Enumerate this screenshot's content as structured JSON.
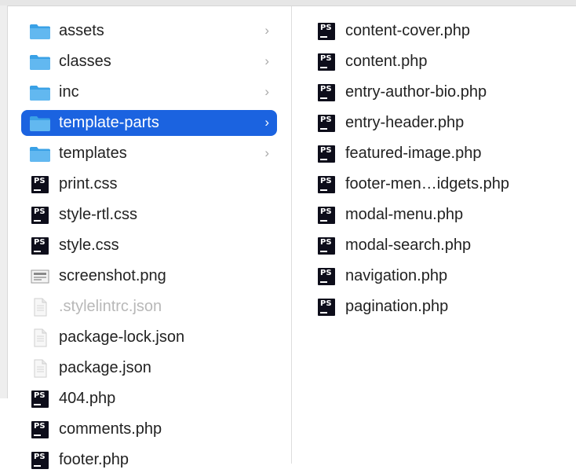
{
  "left_column": {
    "items": [
      {
        "label": "assets",
        "icon": "folder-icon",
        "chevron": "›",
        "selected": false
      },
      {
        "label": "classes",
        "icon": "folder-icon",
        "chevron": "›",
        "selected": false
      },
      {
        "label": "inc",
        "icon": "folder-icon",
        "chevron": "›",
        "selected": false
      },
      {
        "label": "template-parts",
        "icon": "folder-icon",
        "chevron": "›",
        "selected": true
      },
      {
        "label": "templates",
        "icon": "folder-icon",
        "chevron": "›",
        "selected": false
      },
      {
        "label": "print.css",
        "icon": "phpstorm-file-icon"
      },
      {
        "label": "style-rtl.css",
        "icon": "phpstorm-file-icon"
      },
      {
        "label": "style.css",
        "icon": "phpstorm-file-icon"
      },
      {
        "label": "screenshot.png",
        "icon": "image-file-icon"
      },
      {
        "label": ".stylelintrc.json",
        "icon": "document-icon",
        "dimmed": true
      },
      {
        "label": "package-lock.json",
        "icon": "document-icon"
      },
      {
        "label": "package.json",
        "icon": "document-icon"
      },
      {
        "label": "404.php",
        "icon": "phpstorm-file-icon"
      },
      {
        "label": "comments.php",
        "icon": "phpstorm-file-icon"
      },
      {
        "label": "footer.php",
        "icon": "phpstorm-file-icon"
      }
    ]
  },
  "right_column": {
    "items": [
      {
        "label": "content-cover.php",
        "icon": "phpstorm-file-icon"
      },
      {
        "label": "content.php",
        "icon": "phpstorm-file-icon"
      },
      {
        "label": "entry-author-bio.php",
        "icon": "phpstorm-file-icon"
      },
      {
        "label": "entry-header.php",
        "icon": "phpstorm-file-icon"
      },
      {
        "label": "featured-image.php",
        "icon": "phpstorm-file-icon"
      },
      {
        "label": "footer-men…idgets.php",
        "icon": "phpstorm-file-icon"
      },
      {
        "label": "modal-menu.php",
        "icon": "phpstorm-file-icon"
      },
      {
        "label": "modal-search.php",
        "icon": "phpstorm-file-icon"
      },
      {
        "label": "navigation.php",
        "icon": "phpstorm-file-icon"
      },
      {
        "label": "pagination.php",
        "icon": "phpstorm-file-icon"
      }
    ]
  },
  "icon_badge_text": "PS",
  "colors": {
    "selection": "#1b63e0",
    "folder": "#3aa1e6",
    "phpstorm_badge": "#0d0d1a",
    "dim_text": "#b8b8b8"
  }
}
